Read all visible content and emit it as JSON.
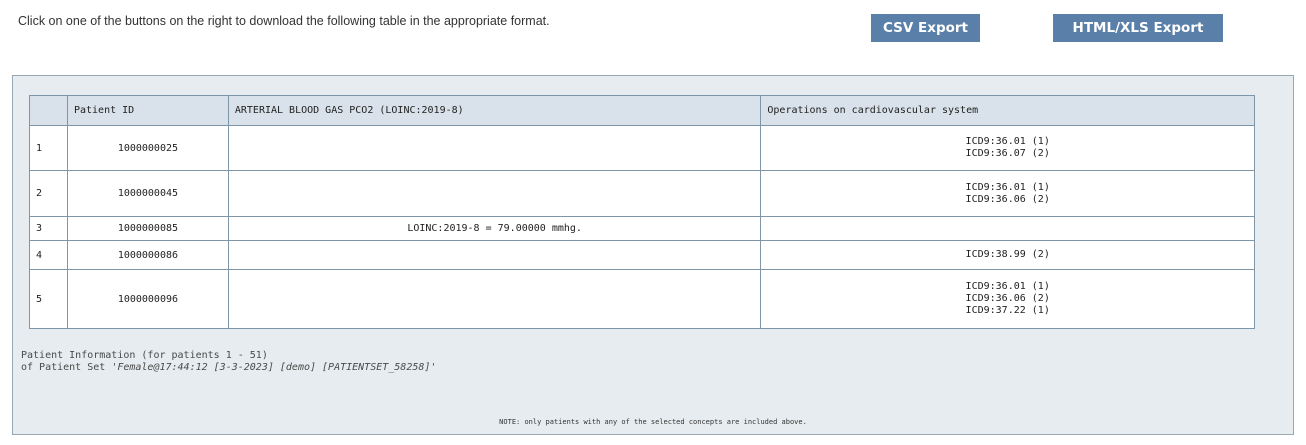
{
  "instruction": "Click on one of the buttons on the right to download the following table in the appropriate format.",
  "buttons": {
    "csv": "CSV Export",
    "html_xls": "HTML/XLS Export"
  },
  "colors": {
    "button": "#5a7fa8",
    "panel": "#e6ecef",
    "header": "#d9e2ea",
    "border": "#7f95a8"
  },
  "table": {
    "headers": {
      "index": "",
      "patient_id": "Patient ID",
      "abg": "ARTERIAL BLOOD GAS PCO2 (LOINC:2019-8)",
      "ops": "Operations on cardiovascular system"
    },
    "rows": [
      {
        "index": "1",
        "patient_id": "1000000025",
        "abg": "",
        "ops": [
          "ICD9:36.01 (1)",
          "ICD9:36.07 (2)"
        ]
      },
      {
        "index": "2",
        "patient_id": "1000000045",
        "abg": "",
        "ops": [
          "ICD9:36.01 (1)",
          "ICD9:36.06 (2)"
        ]
      },
      {
        "index": "3",
        "patient_id": "1000000085",
        "abg": "LOINC:2019-8 = 79.00000 mmhg.",
        "ops": []
      },
      {
        "index": "4",
        "patient_id": "1000000086",
        "abg": "",
        "ops": [
          "ICD9:38.99 (2)"
        ]
      },
      {
        "index": "5",
        "patient_id": "1000000096",
        "abg": "",
        "ops": [
          "ICD9:36.01 (1)",
          "ICD9:36.06 (2)",
          "ICD9:37.22 (1)"
        ]
      }
    ]
  },
  "footer": {
    "info_line1": "Patient Information (for patients 1 - 51)",
    "info_line2_prefix": "of Patient Set ",
    "set_name": "'Female@17:44:12 [3-3-2023] [demo] [PATIENTSET_58258]'",
    "note": "NOTE: only patients with any of the selected concepts are included above."
  }
}
